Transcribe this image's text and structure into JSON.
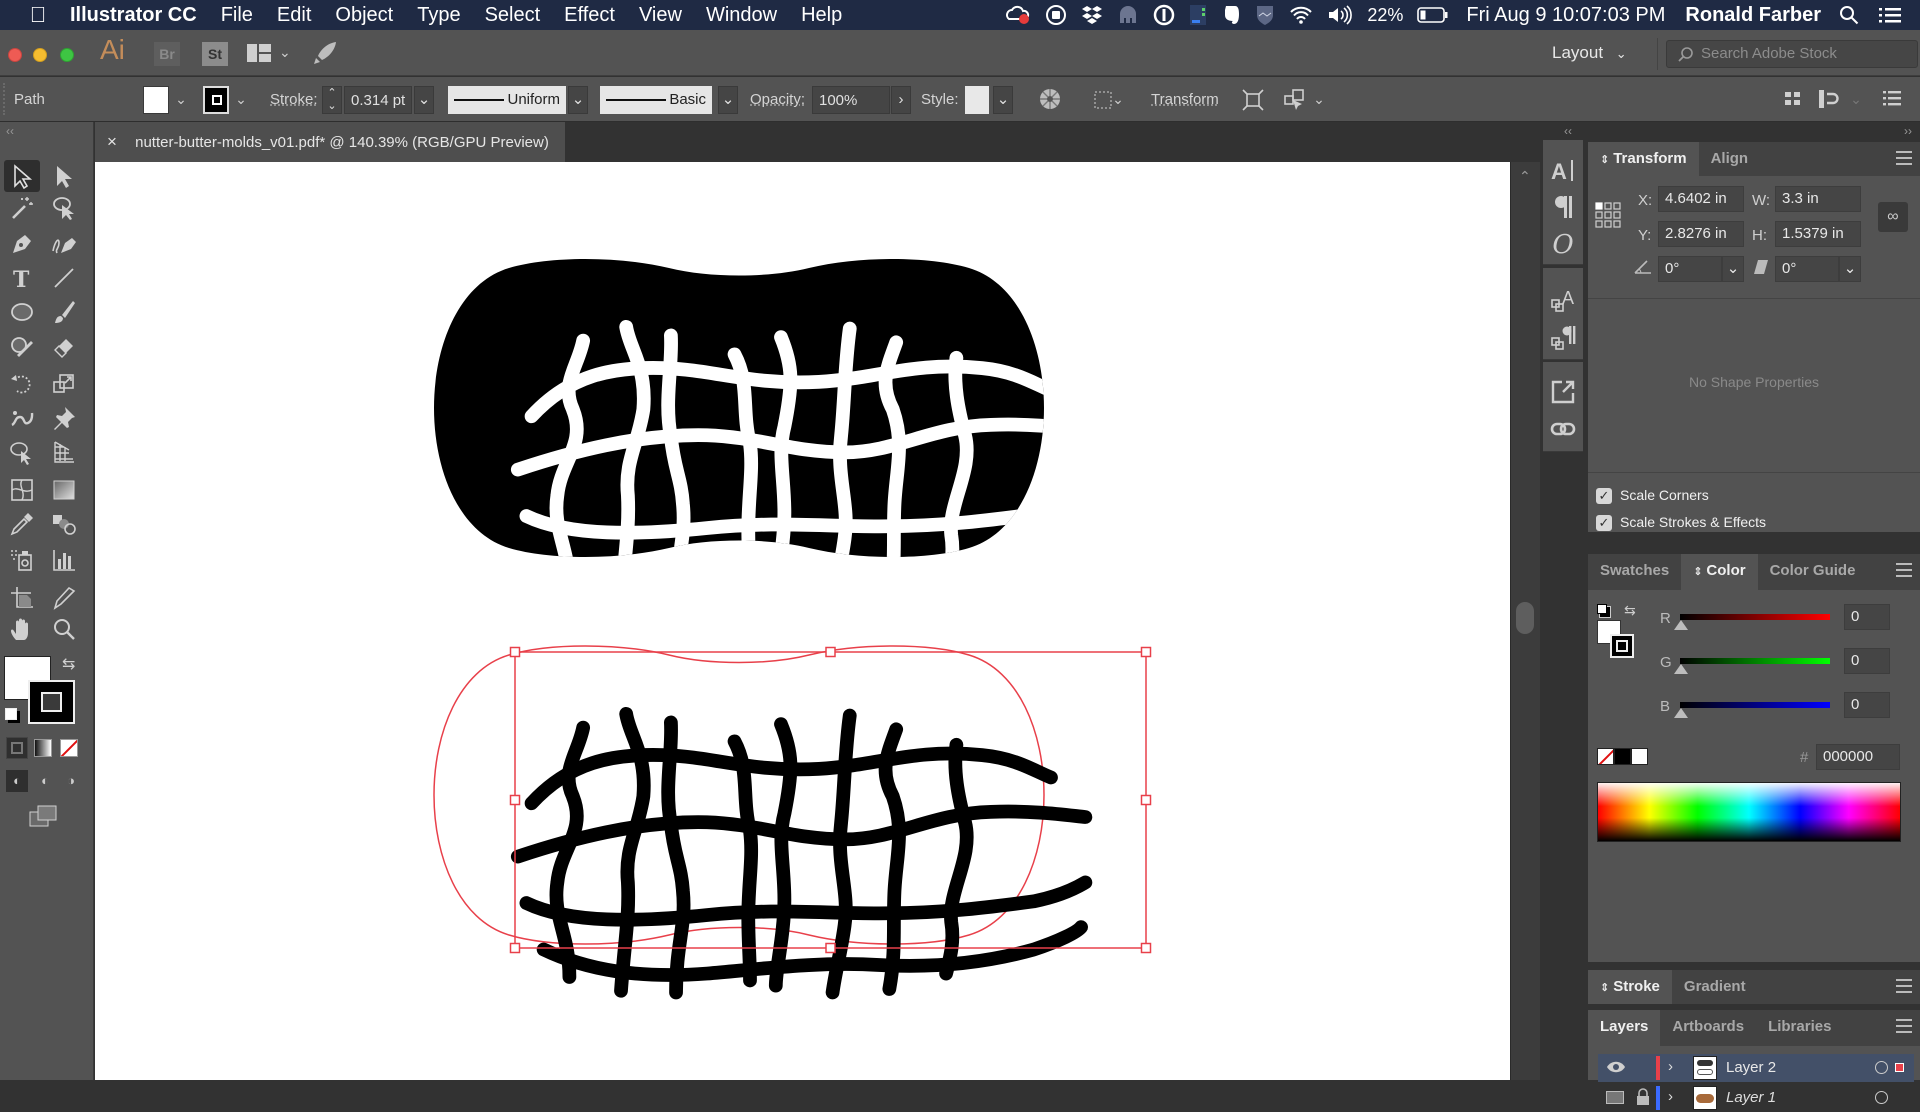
{
  "menubar": {
    "apple_icon": "apple-icon",
    "app_name": "Illustrator CC",
    "menus": [
      "File",
      "Edit",
      "Object",
      "Type",
      "Select",
      "Effect",
      "View",
      "Window",
      "Help"
    ],
    "status_icons": [
      "creative-cloud-icon",
      "stop-record-icon",
      "dropbox-icon",
      "evernote-gray-icon",
      "onepassword-icon",
      "istat-icon",
      "evernote-icon",
      "shield-icon",
      "wifi-icon",
      "volume-icon"
    ],
    "battery": "22%",
    "datetime": "Fri Aug 9  10:07:03 PM",
    "user": "Ronald Farber"
  },
  "appbar": {
    "logo": "Ai",
    "bridge": "Br",
    "stock": "St",
    "workspace": "Layout",
    "search_placeholder": "Search Adobe Stock"
  },
  "control": {
    "selection_type": "Path",
    "stroke_label": "Stroke:",
    "stroke_value": "0.314 pt",
    "profile": "Uniform",
    "brush": "Basic",
    "opacity_label": "Opacity:",
    "opacity_value": "100%",
    "style_label": "Style:",
    "transform_label": "Transform"
  },
  "document": {
    "tab_title": "nutter-butter-molds_v01.pdf* @ 140.39% (RGB/GPU Preview)",
    "close": "×"
  },
  "transform_panel": {
    "tabs": [
      "Transform",
      "Align"
    ],
    "x_label": "X:",
    "x": "4.6402 in",
    "y_label": "Y:",
    "y": "2.8276 in",
    "w_label": "W:",
    "w": "3.3 in",
    "h_label": "H:",
    "h": "1.5379 in",
    "rotate": "0°",
    "shear": "0°",
    "no_shape": "No Shape Properties",
    "scale_corners": "Scale Corners",
    "scale_strokes": "Scale Strokes & Effects",
    "scale_corners_checked": true,
    "scale_strokes_checked": true
  },
  "color_panel": {
    "tabs": [
      "Swatches",
      "Color",
      "Color Guide"
    ],
    "r_label": "R",
    "r": "0",
    "g_label": "G",
    "g": "0",
    "b_label": "B",
    "b": "0",
    "hash": "#",
    "hex": "000000",
    "colors": {
      "r_track": "#ff0000",
      "g_track": "#00ff00",
      "b_track": "#0000ff"
    }
  },
  "stroke_panel": {
    "tabs": [
      "Stroke",
      "Gradient"
    ]
  },
  "layers_panel": {
    "tabs": [
      "Layers",
      "Artboards",
      "Libraries"
    ],
    "layers": [
      {
        "name": "Layer 2",
        "color": "#e8404a",
        "visible": true,
        "locked": false,
        "selected": true
      },
      {
        "name": "Layer 1",
        "color": "#3b6bff",
        "visible": false,
        "locked": true,
        "selected": false
      }
    ]
  },
  "canvas": {
    "selection_color": "#e8404a",
    "objects": [
      "peanut-mold-filled",
      "peanut-mold-outline-selected"
    ]
  }
}
